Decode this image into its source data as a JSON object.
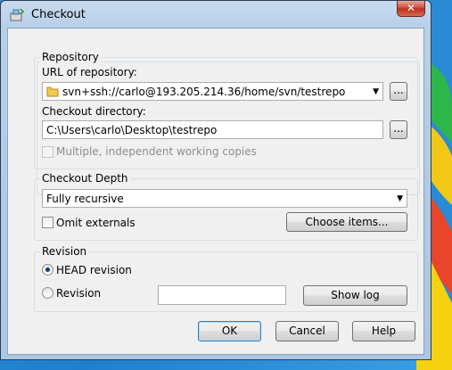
{
  "window": {
    "title": "Checkout",
    "close_symbol": "✕"
  },
  "repository": {
    "group_label": "Repository",
    "url_label": "URL of repository:",
    "url_value": "svn+ssh://carlo@193.205.214.36/home/svn/testrepo",
    "browse_label": "...",
    "dir_label": "Checkout directory:",
    "dir_value": "C:\\Users\\carlo\\Desktop\\testrepo",
    "dir_browse_label": "...",
    "multiple_label": "Multiple, independent working copies",
    "multiple_checked": false
  },
  "depth": {
    "group_label": "Checkout Depth",
    "selected": "Fully recursive",
    "omit_label": "Omit externals",
    "omit_checked": false,
    "choose_label": "Choose items..."
  },
  "revision": {
    "group_label": "Revision",
    "head_label": "HEAD revision",
    "rev_label": "Revision",
    "rev_value": "",
    "selected": "HEAD revision",
    "show_log_label": "Show log"
  },
  "buttons": {
    "ok": "OK",
    "cancel": "Cancel",
    "help": "Help"
  },
  "icons": {
    "title": "checkout-icon",
    "folder": "folder-icon",
    "dropdown": "chevron-down-icon"
  }
}
